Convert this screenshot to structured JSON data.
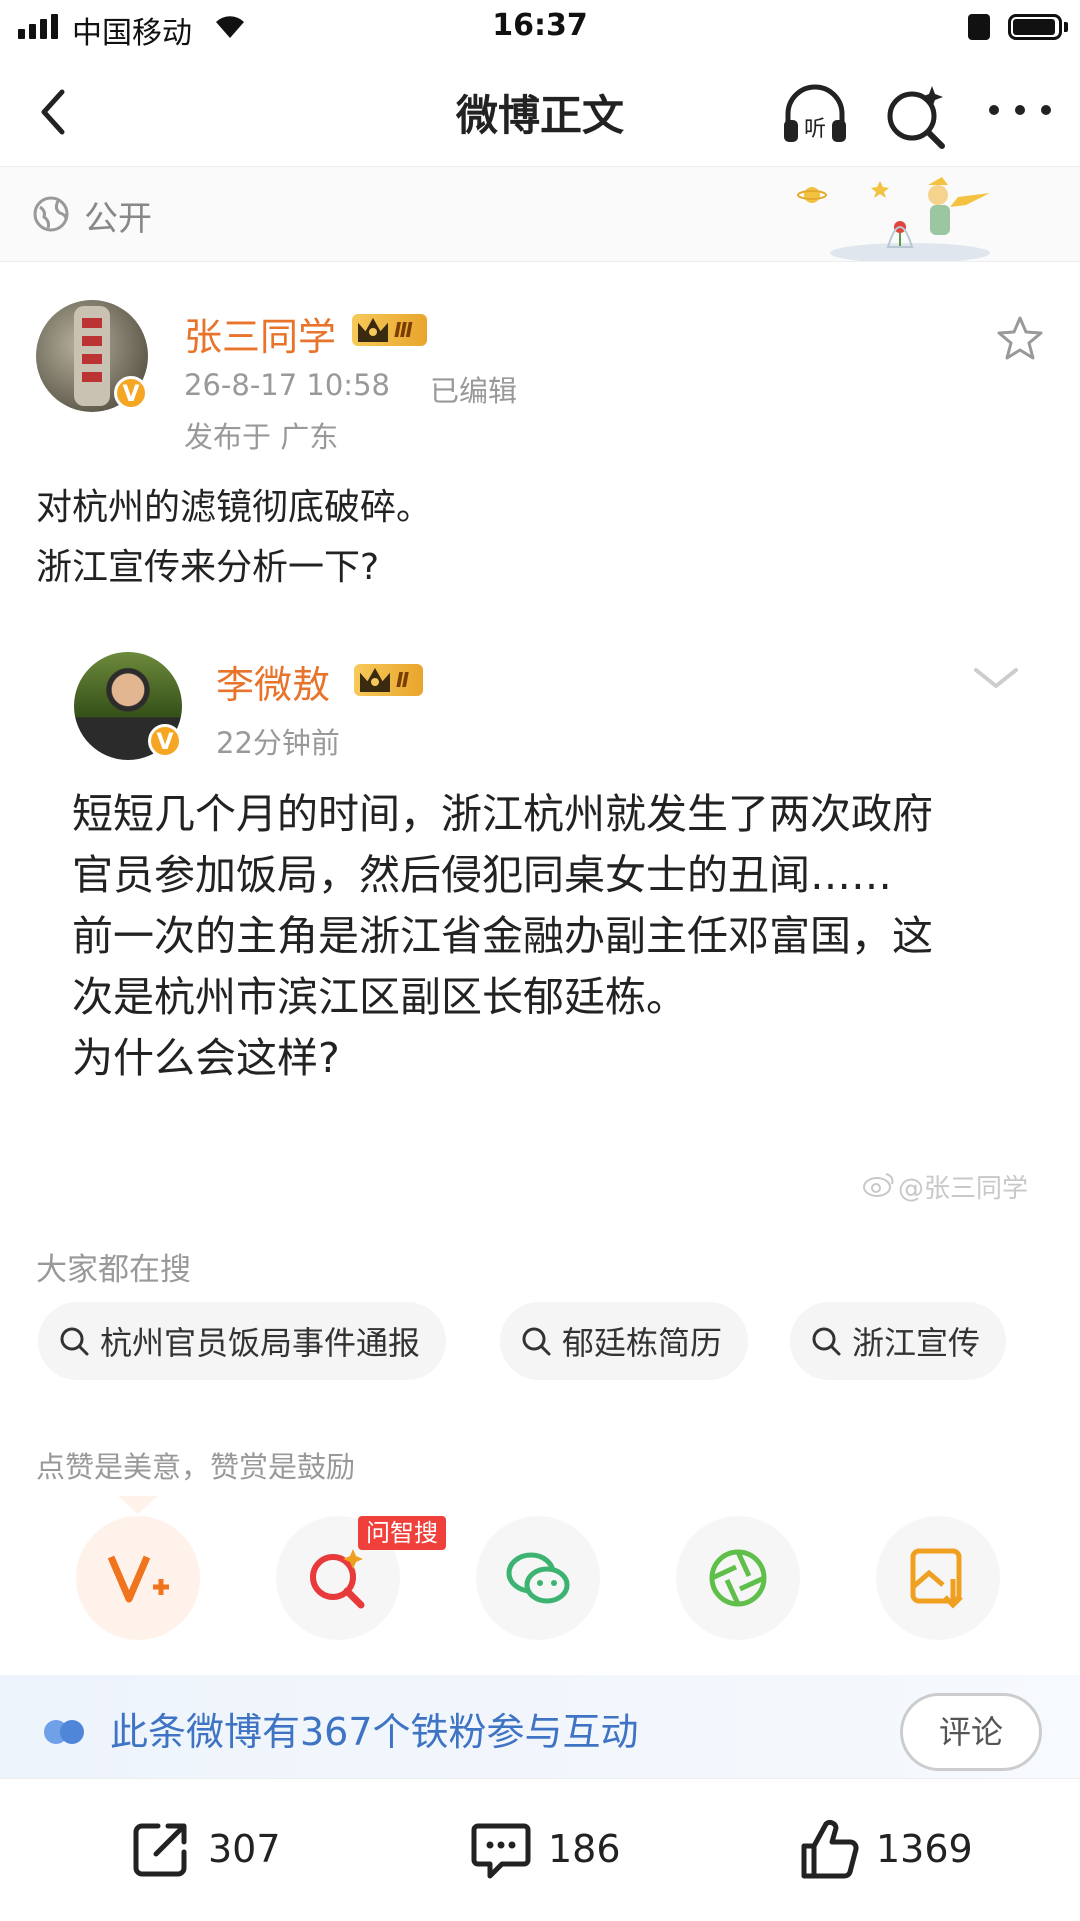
{
  "status_bar": {
    "carrier": "中国移动",
    "time": "16:37"
  },
  "nav": {
    "title": "微博正文"
  },
  "visibility": {
    "label": "公开"
  },
  "post": {
    "author": "张三同学",
    "level": "Ⅲ",
    "timestamp": "26-8-17 10:58",
    "edited": "已编辑",
    "location": "发布于 广东",
    "lines": [
      "对杭州的滤镜彻底破碎。",
      "浙江宣传来分析一下?"
    ]
  },
  "repost": {
    "author": "李微敖",
    "level": "Ⅱ",
    "time_ago": "22分钟前",
    "lines": [
      "短短几个月的时间，浙江杭州就发生了两次政府",
      "官员参加饭局，然后侵犯同桌女士的丑闻……",
      "前一次的主角是浙江省金融办副主任邓富国，这",
      "次是杭州市滨江区副区长郁廷栋。",
      "为什么会这样?"
    ],
    "watermark": "@张三同学"
  },
  "search_section": {
    "title": "大家都在搜",
    "chips": [
      "杭州官员饭局事件通报",
      "郁廷栋简历",
      "浙江宣传"
    ]
  },
  "reward": {
    "title": "点赞是美意，赞赏是鼓励",
    "ask_tag": "问智搜"
  },
  "interaction": {
    "text": "此条微博有367个铁粉参与互动",
    "comment_button": "评论"
  },
  "bottom_bar": {
    "reposts": "307",
    "comments": "186",
    "likes": "1369"
  },
  "colors": {
    "username": "#e8732a",
    "accent_blue": "#3f74c4",
    "badge_red": "#f0403c"
  }
}
